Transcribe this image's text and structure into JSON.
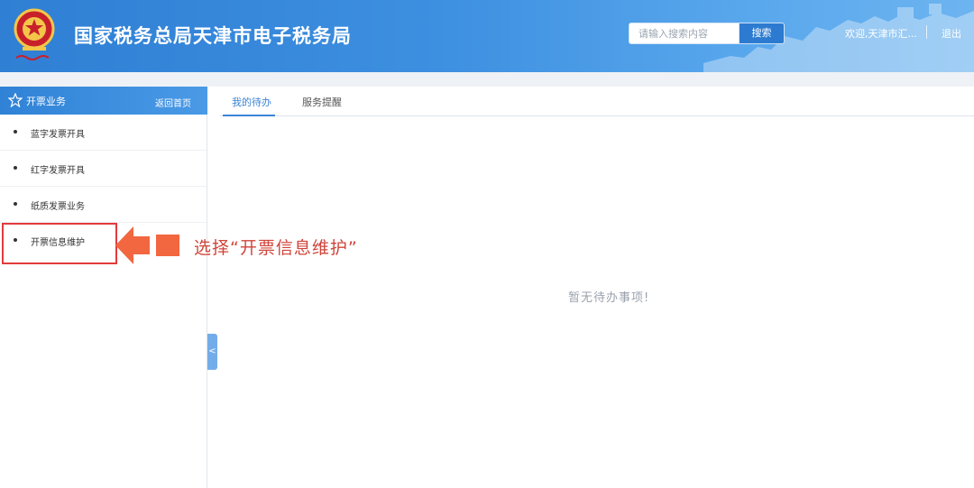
{
  "header": {
    "title": "国家税务总局天津市电子税务局",
    "search": {
      "placeholder": "请输入搜索内容",
      "button_label": "搜索"
    },
    "welcome": "欢迎,天津市汇...",
    "logout": "退出"
  },
  "sidebar": {
    "section_title": "开票业务",
    "back_home": "返回首页",
    "items": [
      {
        "label": "蓝字发票开具"
      },
      {
        "label": "红字发票开具"
      },
      {
        "label": "纸质发票业务"
      },
      {
        "label": "开票信息维护"
      }
    ],
    "collapse_glyph": "<"
  },
  "main": {
    "tabs": [
      {
        "label": "我的待办",
        "active": true
      },
      {
        "label": "服务提醒",
        "active": false
      }
    ],
    "empty_text": "暂无待办事项!"
  },
  "annotation": {
    "text": "选择“开票信息维护”"
  },
  "colors": {
    "header_blue": "#3d8fe0",
    "accent": "#3b84d6",
    "annotation_red": "#e23b3b",
    "arrow_orange": "#f2673f"
  }
}
